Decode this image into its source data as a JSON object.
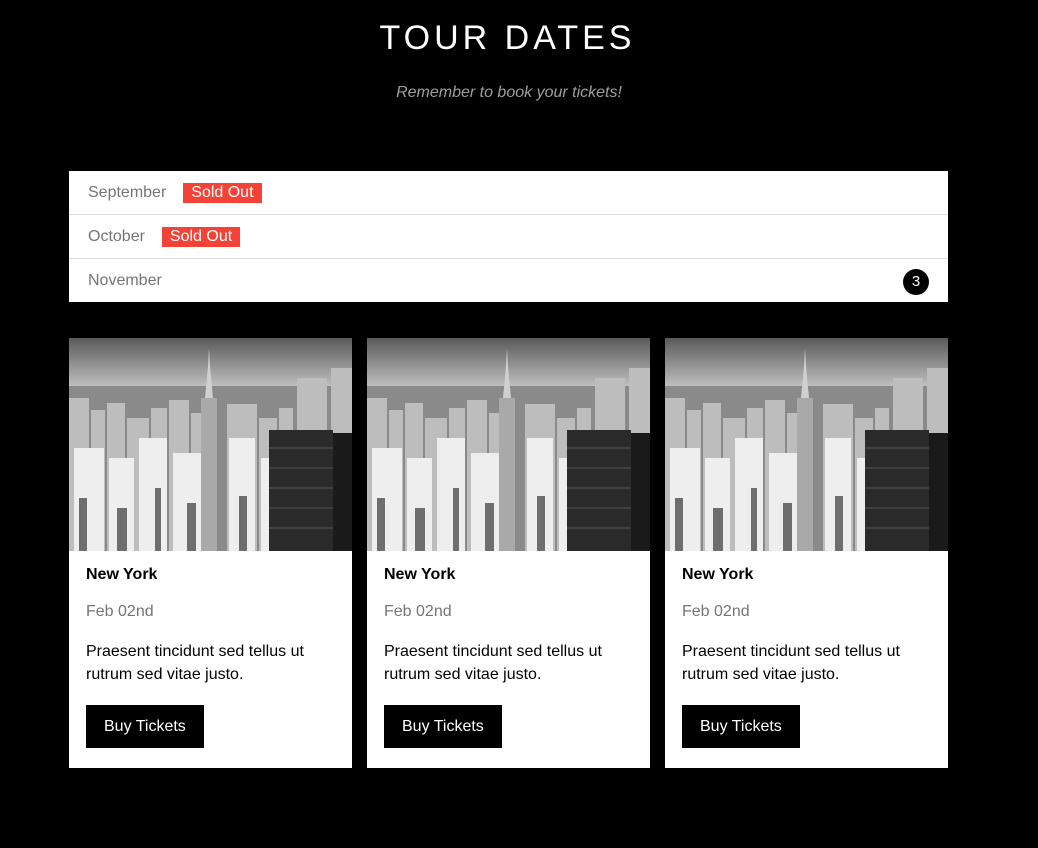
{
  "header": {
    "title": "TOUR DATES",
    "subtitle": "Remember to book your tickets!"
  },
  "months": [
    {
      "label": "September",
      "badge": "Sold Out"
    },
    {
      "label": "October",
      "badge": "Sold Out"
    },
    {
      "label": "November",
      "count": "3"
    }
  ],
  "cards": [
    {
      "image": "new-york-skyline",
      "city": "New York",
      "date": "Feb 02nd",
      "description": "Praesent tincidunt sed tellus ut rutrum sed vitae justo.",
      "button": "Buy Tickets"
    },
    {
      "image": "new-york-skyline",
      "city": "New York",
      "date": "Feb 02nd",
      "description": "Praesent tincidunt sed tellus ut rutrum sed vitae justo.",
      "button": "Buy Tickets"
    },
    {
      "image": "new-york-skyline",
      "city": "New York",
      "date": "Feb 02nd",
      "description": "Praesent tincidunt sed tellus ut rutrum sed vitae justo.",
      "button": "Buy Tickets"
    }
  ],
  "colors": {
    "background": "#000000",
    "sold_out": "#f44336",
    "muted_text": "#757575"
  }
}
